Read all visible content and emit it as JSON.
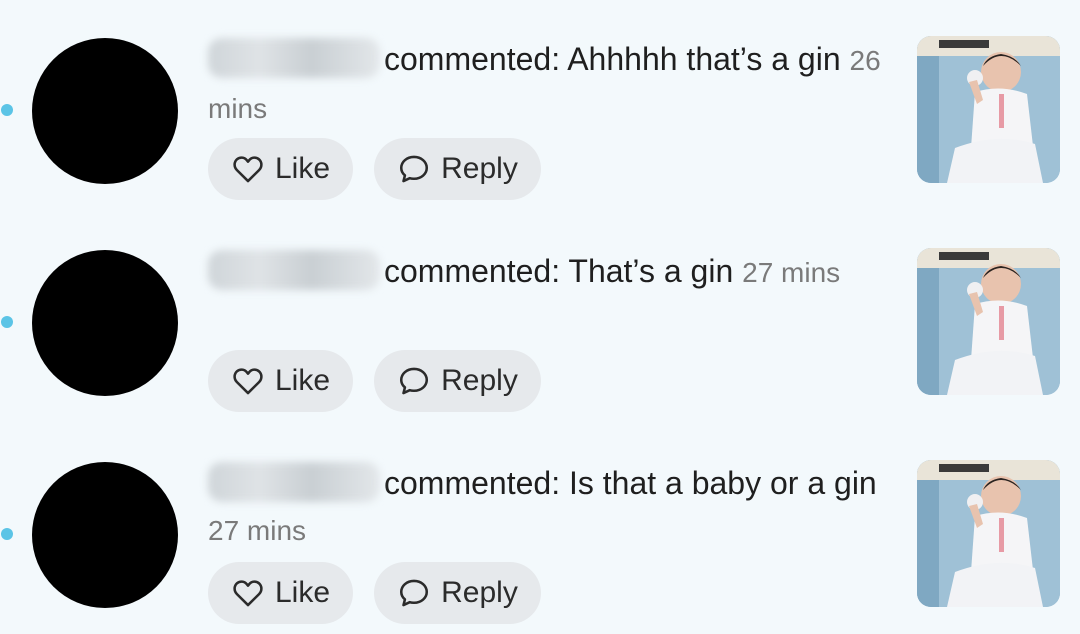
{
  "comments": [
    {
      "commenter": "",
      "text": "commented: Ahhhhh that’s a gin",
      "time": "26 mins",
      "like_label": "Like",
      "reply_label": "Reply"
    },
    {
      "commenter": "",
      "text": "commented: That’s a gin",
      "time": "27 mins",
      "like_label": "Like",
      "reply_label": "Reply"
    },
    {
      "commenter": "",
      "text": "commented: Is that a baby or a gin",
      "time": "27 mins",
      "like_label": "Like",
      "reply_label": "Reply"
    }
  ],
  "icons": {
    "like": "heart-icon",
    "reply": "speech-bubble-icon"
  },
  "colors": {
    "background": "#f3f9fc",
    "unread_dot": "#5bc4e6",
    "button_bg": "#e6e9ec",
    "timestamp": "#7a7a7a"
  }
}
